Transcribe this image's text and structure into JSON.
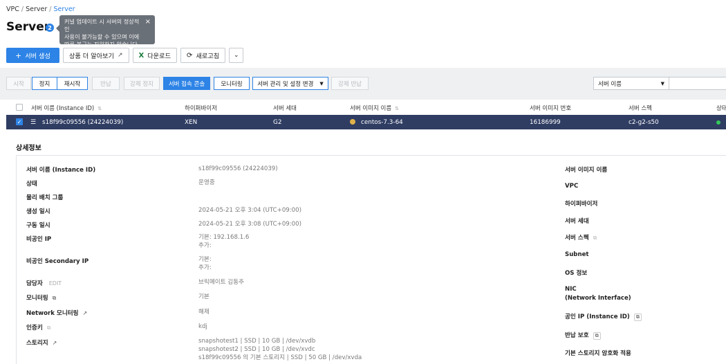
{
  "breadcrumb": {
    "level1": "VPC",
    "level2": "Server",
    "level3": "Server"
  },
  "page": {
    "title": "Server",
    "help_badge": "2"
  },
  "tooltip": {
    "line1": "커널 업데이트 시 서버의 정상적인",
    "line2": "사용이 불가능할 수 있으며 이에",
    "line3": "따른 복구는 지원하지 않습니다.",
    "close": "×"
  },
  "toolbar": {
    "create": "서버 생성",
    "learn_more": "상품 더 알아보기",
    "download": "다운로드",
    "refresh": "새로고침"
  },
  "actions": {
    "start": "시작",
    "stop": "정지",
    "restart": "재시작",
    "return": "반납",
    "force_stop": "강제 정지",
    "console": "서버 접속 콘솔",
    "monitoring": "모니터링",
    "manage": "서버 관리 및 설정 변경",
    "force_return": "강제 반납"
  },
  "filter": {
    "selected": "서버 이름"
  },
  "table": {
    "headers": {
      "name": "서버 이름 (Instance ID)",
      "hypervisor": "하이퍼바이저",
      "generation": "서버 세대",
      "image": "서버 이미지 이름",
      "image_no": "서버 이미지 번호",
      "spec": "서버 스펙",
      "status": "상태"
    },
    "row": {
      "name": "s18f99c09556 (24224039)",
      "hypervisor": "XEN",
      "generation": "G2",
      "image": "centos-7.3-64",
      "image_no": "16186999",
      "spec": "c2-g2-s50"
    }
  },
  "detail": {
    "title": "상세정보",
    "left": {
      "name_label": "서버 이름 (Instance ID)",
      "name_value": "s18f99c09556 (24224039)",
      "status_label": "상태",
      "status_value": "운영중",
      "placement_label": "물리 배치 그룹",
      "created_label": "생성 일시",
      "created_value": "2024-05-21 오후 3:04 (UTC+09:00)",
      "started_label": "구동 일시",
      "started_value": "2024-05-21 오후 3:08 (UTC+09:00)",
      "private_ip_label": "비공인 IP",
      "private_ip_value1": "기본: 192.168.1.6",
      "private_ip_value2": "추가:",
      "secondary_label": "비공인 Secondary IP",
      "secondary_value1": "기본:",
      "secondary_value2": "추가:",
      "owner_label": "담당자",
      "owner_edit": "EDIT",
      "owner_value": "브릭메이트 김동주",
      "monitoring_label": "모니터링",
      "monitoring_value": "기본",
      "netmon_label": "Network 모니터링",
      "netmon_value": "해제",
      "authkey_label": "인증키",
      "authkey_value": "kdj",
      "storage_label": "스토리지",
      "storage_value1": "snapshotest1 | SSD | 10 GB | /dev/xvdb",
      "storage_value2": "snapshotest2 | SSD | 10 GB | /dev/xvdc",
      "storage_value3": "s18f99c09556 의 기본 스토리지 | SSD | 50 GB | /dev/xvda"
    },
    "right": {
      "image_label": "서버 이미지 이름",
      "vpc_label": "VPC",
      "hypervisor_label": "하이퍼바이저",
      "generation_label": "서버 세대",
      "spec_label": "서버 스펙",
      "subnet_label": "Subnet",
      "os_label": "OS 정보",
      "nic_label1": "NIC",
      "nic_label2": "(Network Interface)",
      "public_ip_label": "공인 IP (Instance ID)",
      "return_protect_label": "반납 보호",
      "encryption_label": "기본 스토리지 암호화 적용"
    }
  }
}
